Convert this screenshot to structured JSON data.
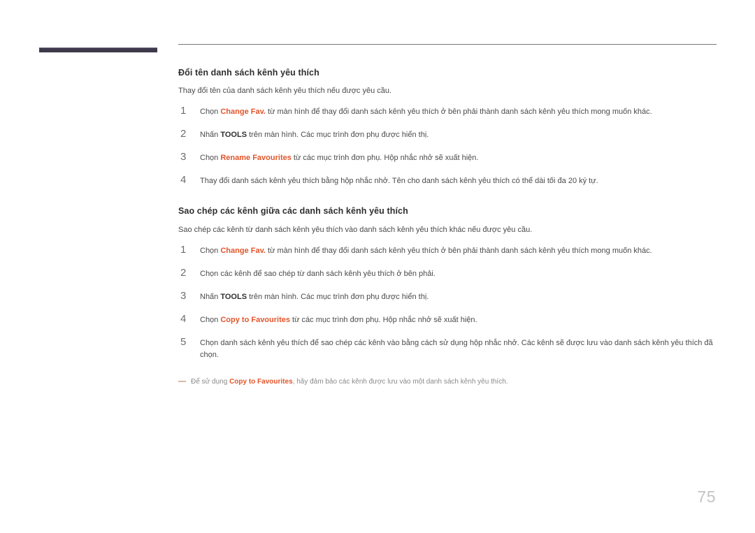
{
  "page": {
    "number": "75"
  },
  "sections": [
    {
      "heading": "Đổi tên danh sách kênh yêu thích",
      "intro": "Thay đổi tên của danh sách kênh yêu thích nếu được yêu cầu.",
      "steps": [
        {
          "number": "1",
          "before": "Chọn ",
          "term": "Change Fav.",
          "term_style": "ui-term",
          "after": " từ màn hình để thay đổi danh sách kênh yêu thích ở bên phải thành danh sách kênh yêu thích mong muốn khác."
        },
        {
          "number": "2",
          "before": "Nhấn ",
          "term": "TOOLS",
          "term_style": "key-term",
          "after": " trên màn hình. Các mục trình đơn phụ được hiển thị."
        },
        {
          "number": "3",
          "before": "Chọn ",
          "term": "Rename Favourites",
          "term_style": "ui-term",
          "after": " từ các mục trình đơn phụ. Hộp nhắc nhở sẽ xuất hiện."
        },
        {
          "number": "4",
          "before": "Thay đổi danh sách kênh yêu thích bằng hộp nhắc nhở. Tên cho danh sách kênh yêu thích có thể dài tối đa 20 ký tự.",
          "term": "",
          "term_style": "ui-term",
          "after": ""
        }
      ]
    },
    {
      "heading": "Sao chép các kênh giữa các danh sách kênh yêu thích",
      "intro": "Sao chép các kênh từ danh sách kênh yêu thích vào danh sách kênh yêu thích khác nếu được yêu cầu.",
      "steps": [
        {
          "number": "1",
          "before": "Chọn ",
          "term": "Change Fav.",
          "term_style": "ui-term",
          "after": " từ màn hình để thay đổi danh sách kênh yêu thích ở bên phải thành danh sách kênh yêu thích mong muốn khác."
        },
        {
          "number": "2",
          "before": "Chọn các kênh để sao chép từ danh sách kênh yêu thích ở bên phải.",
          "term": "",
          "term_style": "ui-term",
          "after": ""
        },
        {
          "number": "3",
          "before": "Nhấn ",
          "term": "TOOLS",
          "term_style": "key-term",
          "after": " trên màn hình. Các mục trình đơn phụ được hiển thị."
        },
        {
          "number": "4",
          "before": "Chọn ",
          "term": "Copy to Favourites",
          "term_style": "ui-term",
          "after": " từ các mục trình đơn phụ. Hộp nhắc nhở sẽ xuất hiện."
        },
        {
          "number": "5",
          "before": "Chọn danh sách kênh yêu thích để sao chép các kênh vào bằng cách sử dụng hộp nhắc nhở. Các kênh sẽ được lưu vào danh sách kênh yêu thích đã chọn.",
          "term": "",
          "term_style": "ui-term",
          "after": ""
        }
      ]
    }
  ],
  "note": {
    "before": "Để sử dụng ",
    "term": "Copy to Favourites",
    "after": ", hãy đảm bảo các kênh được lưu vào một danh sách kênh yêu thích."
  },
  "colors": {
    "ui_term": "#e2552b",
    "heading": "#2f2f2f",
    "body": "#4a4a4a",
    "left_bar": "#3e3a4c",
    "rule": "#77767a",
    "page_number": "#c3c3c3"
  }
}
